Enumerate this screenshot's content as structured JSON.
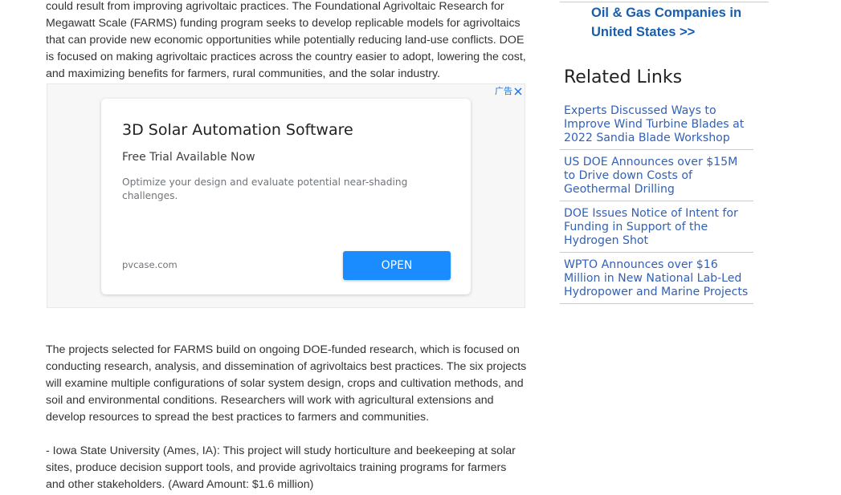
{
  "article": {
    "paragraph_1": "could result from improving agrivoltaic practices. The Foundational Agrivoltaic Research for Megawatt Scale (FARMS) funding program seeks to develop replicable models for agrivoltaics that can provide new economic opportunities while potentially reducing land-use conflicts. DOE is focused on making agrivoltaic practices across the country easier to adopt, lowering the cost, and maximizing benefits for farmers, rural communities, and the solar industry.",
    "paragraph_2": "The projects selected for FARMS build on ongoing DOE-funded research, which is focused on conducting research, analysis, and dissemination of agrivoltaics best practices. The six projects will examine multiple configurations of solar system design, crops and cultivation methods, and soil and environmental conditions. Researchers will work with agricultural extensions and develop resources to spread the best practices to farmers and communities.",
    "paragraph_3": "- Iowa State University (Ames, IA): This project will study horticulture and beekeeping at solar sites, produce decision support tools, and provide agrivoltaics training programs for farmers and other stakeholders. (Award Amount: $1.6 million)"
  },
  "ad": {
    "badge_label": "广告",
    "title": "3D Solar Automation Software",
    "subtitle": "Free Trial Available Now",
    "description": "Optimize your design and evaluate potential near-shading challenges.",
    "domain": "pvcase.com",
    "cta_label": "OPEN",
    "cta_color": "#1a8cff",
    "badge_color": "#1a73e8"
  },
  "sidebar": {
    "prev_link": "Oil & Gas Companies in United States >>",
    "related_heading": "Related Links",
    "related_links": [
      "Experts Discussed Ways to Improve Wind Turbine Blades at 2022 Sandia Blade Workshop",
      "US DOE Announces over $15M to Drive down Costs of Geothermal Drilling",
      "DOE Issues Notice of Intent for Funding in Support of the Hydrogen Shot",
      "WPTO Announces over $16 Million in New National Lab-Led Hydropower and Marine Projects"
    ],
    "link_color": "#3461b4"
  }
}
